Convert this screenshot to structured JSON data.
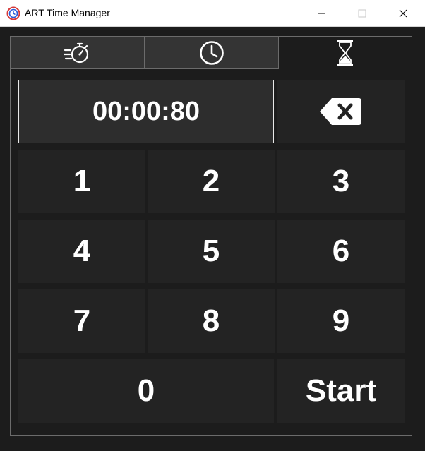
{
  "window": {
    "title": "ART Time Manager",
    "app_icon": "clock-app-icon",
    "controls": [
      "minimize-icon",
      "maximize-icon",
      "close-icon"
    ]
  },
  "tabs": [
    {
      "icon": "stopwatch-icon",
      "selected": false
    },
    {
      "icon": "clock-icon",
      "selected": false
    },
    {
      "icon": "hourglass-icon",
      "selected": true
    }
  ],
  "timer": {
    "display": "00:00:80",
    "backspace_icon": "backspace-icon"
  },
  "keypad": {
    "k1": "1",
    "k2": "2",
    "k3": "3",
    "k4": "4",
    "k5": "5",
    "k6": "6",
    "k7": "7",
    "k8": "8",
    "k9": "9",
    "k0": "0",
    "start": "Start"
  },
  "colors": {
    "background": "#1c1c1c",
    "key": "#232323",
    "display": "#2d2d2d",
    "tab_inactive": "#343434",
    "text": "#ffffff"
  }
}
